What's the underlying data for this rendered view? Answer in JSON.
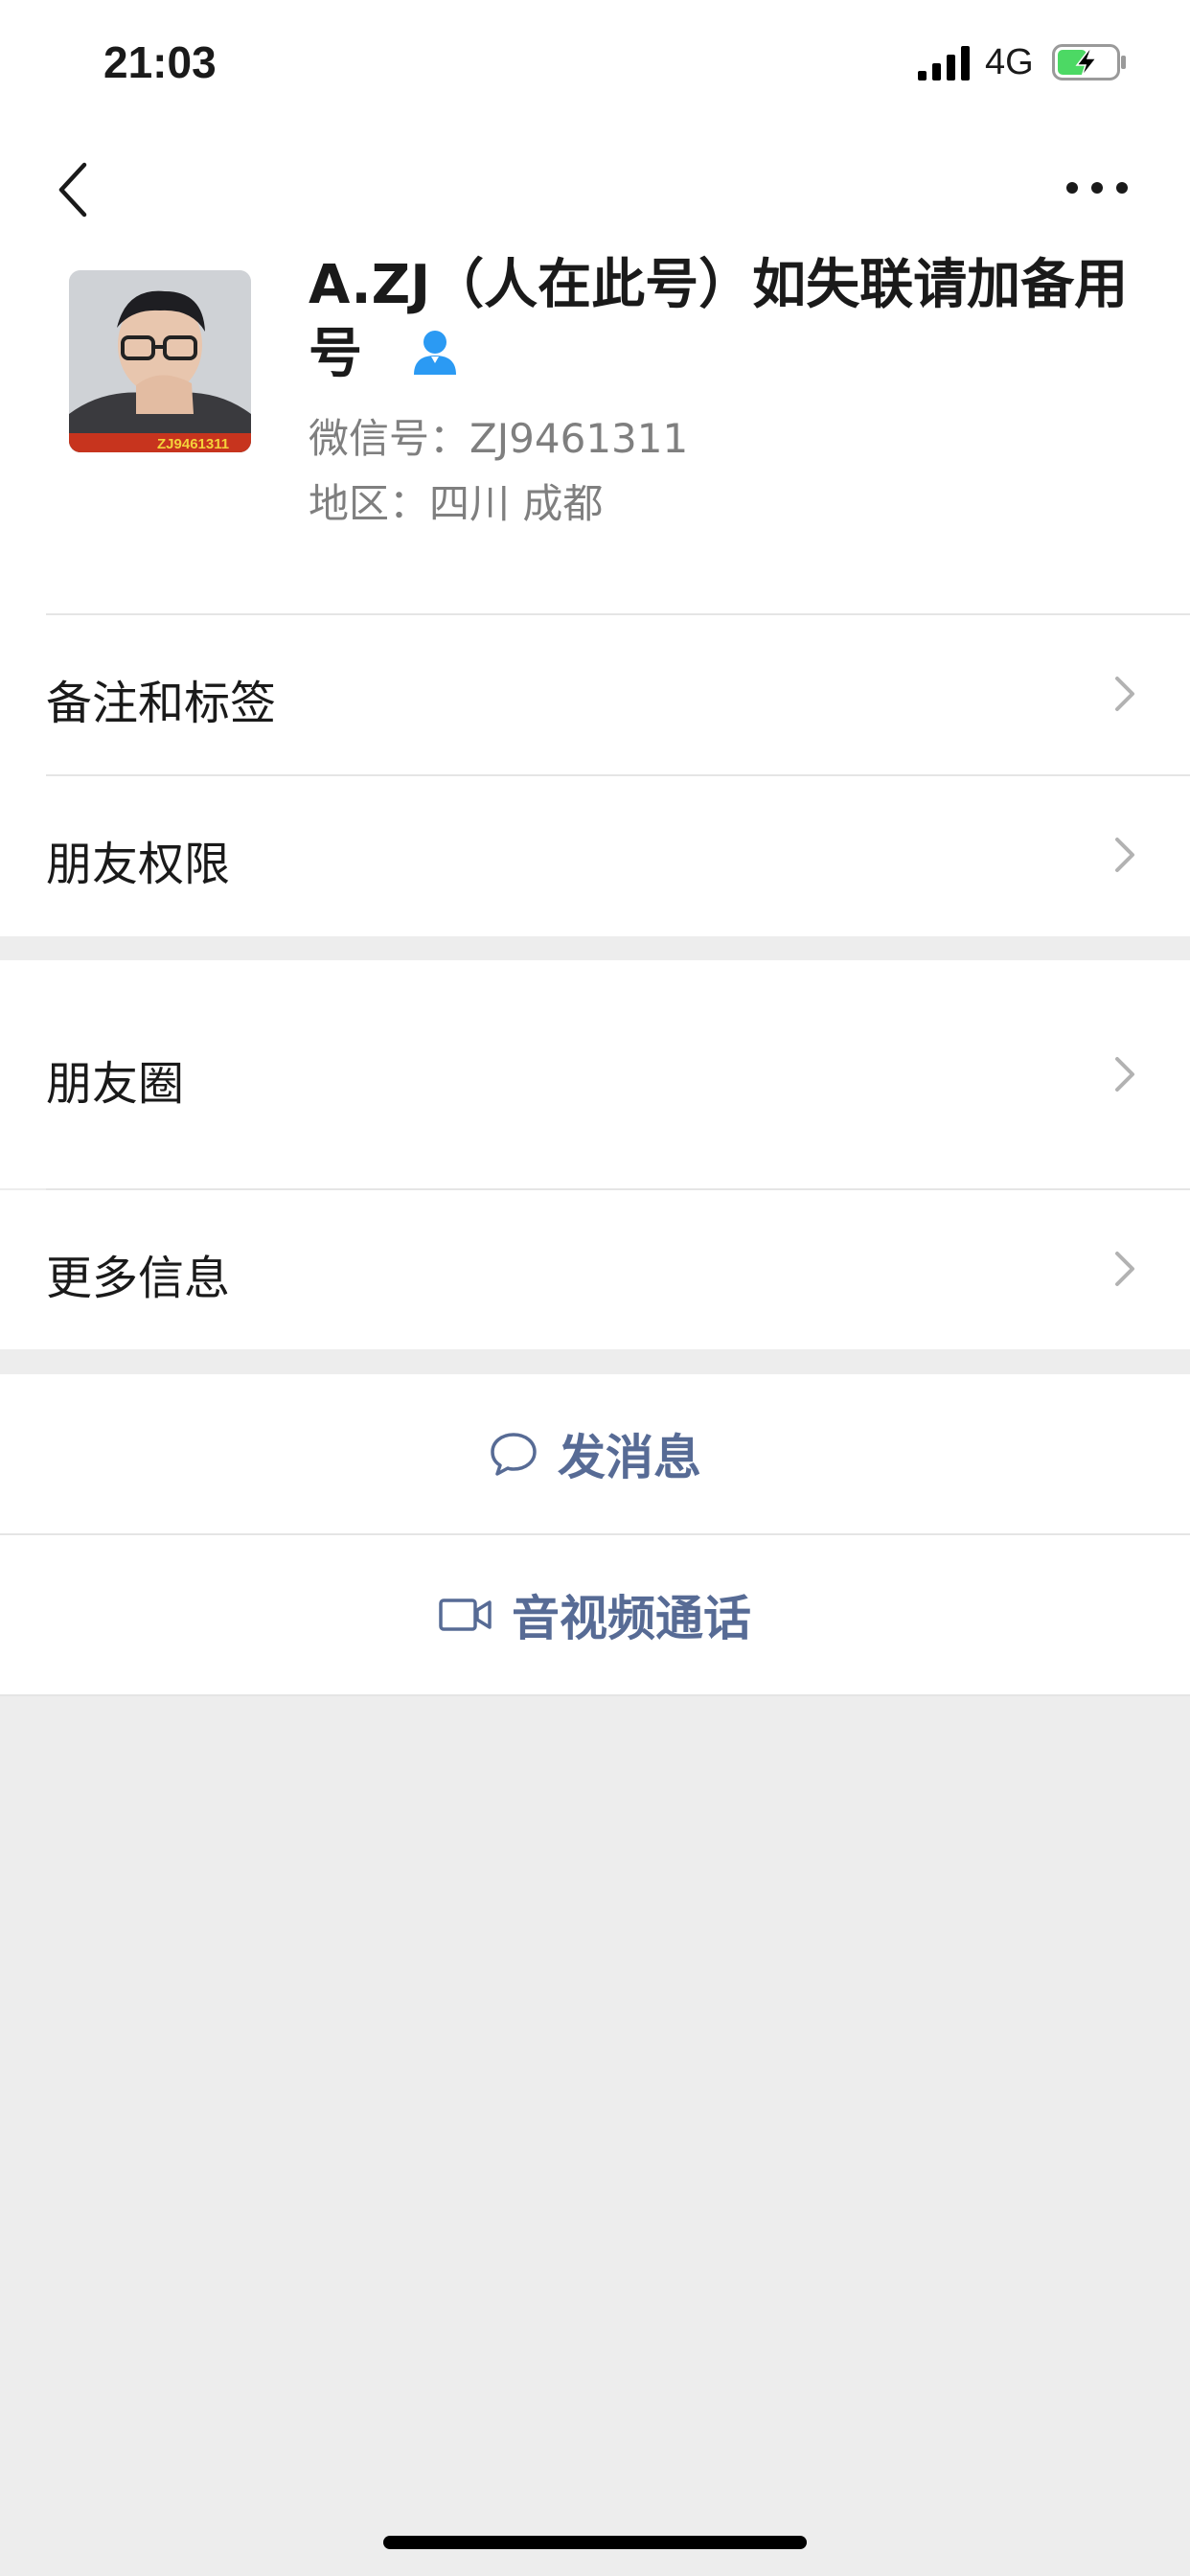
{
  "status_bar": {
    "time": "21:03",
    "network": "4G"
  },
  "nav": {
    "back_icon": "chevron-left-icon",
    "more_icon": "more-horizontal-icon"
  },
  "profile": {
    "name": "A.ZJ（人在此号）如失联请加备用号",
    "wechat_id": "微信号：ZJ9461311",
    "region": "地区：四川 成都",
    "avatar_caption": "ZJ9461311",
    "badge_icon": "contact-person-icon"
  },
  "menu": {
    "remark_tags": "备注和标签",
    "friend_permissions": "朋友权限",
    "moments": "朋友圈",
    "more_info": "更多信息"
  },
  "actions": {
    "send_message": "发消息",
    "video_call": "音视频通话"
  },
  "colors": {
    "link": "#576b95",
    "background": "#ededed",
    "badge": "#2b9af3",
    "battery": "#4cd964"
  }
}
